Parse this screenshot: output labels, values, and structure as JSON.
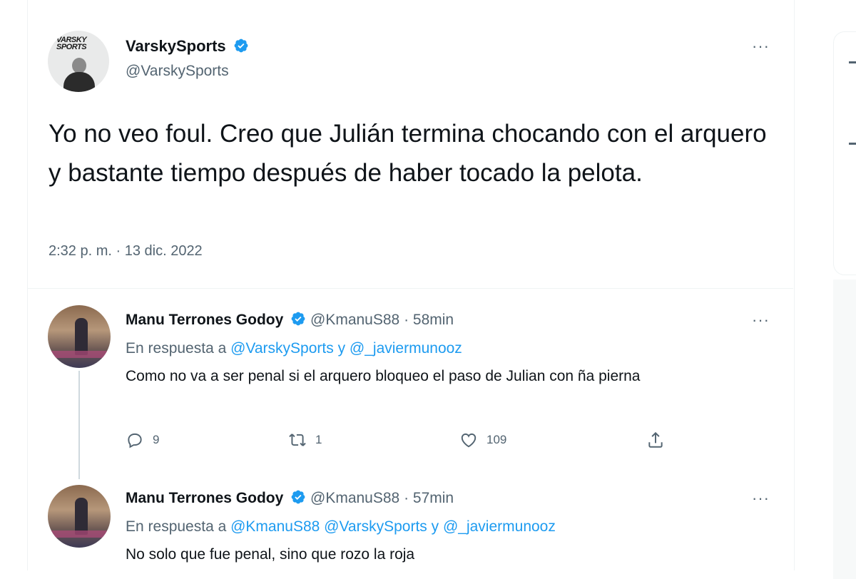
{
  "main_tweet": {
    "author_name": "VarskySports",
    "handle": "@VarskySports",
    "avatar_logo_text": "VARSKY SPORTS",
    "text": "Yo no veo foul. Creo que Julián termina chocando con el arquero y bastante tiempo después de haber tocado la pelota.",
    "timestamp": "2:32 p. m. · 13 dic. 2022"
  },
  "replies": [
    {
      "author_name": "Manu Terrones Godoy",
      "handle": "@KmanuS88",
      "time_ago": "· 58min",
      "reply_prefix": "En respuesta a",
      "mentions": "@VarskySports y @_javiermunooz",
      "text": "Como no va a ser penal si el arquero bloqueo el paso de Julian con ña pierna",
      "stats": {
        "replies": "9",
        "retweets": "1",
        "likes": "109"
      }
    },
    {
      "author_name": "Manu Terrones Godoy",
      "handle": "@KmanuS88",
      "time_ago": "· 57min",
      "reply_prefix": "En respuesta a",
      "mentions": "@KmanuS88 @VarskySports y @_javiermunooz",
      "text": "No solo que fue penal, sino que rozo la roja"
    }
  ],
  "more_label": "···",
  "icons": [
    "verified-badge-icon",
    "reply-icon",
    "retweet-icon",
    "like-icon",
    "share-icon",
    "more-icon"
  ],
  "colors": {
    "accent": "#1d9bf0",
    "muted": "#536471",
    "text": "#0f1419"
  }
}
